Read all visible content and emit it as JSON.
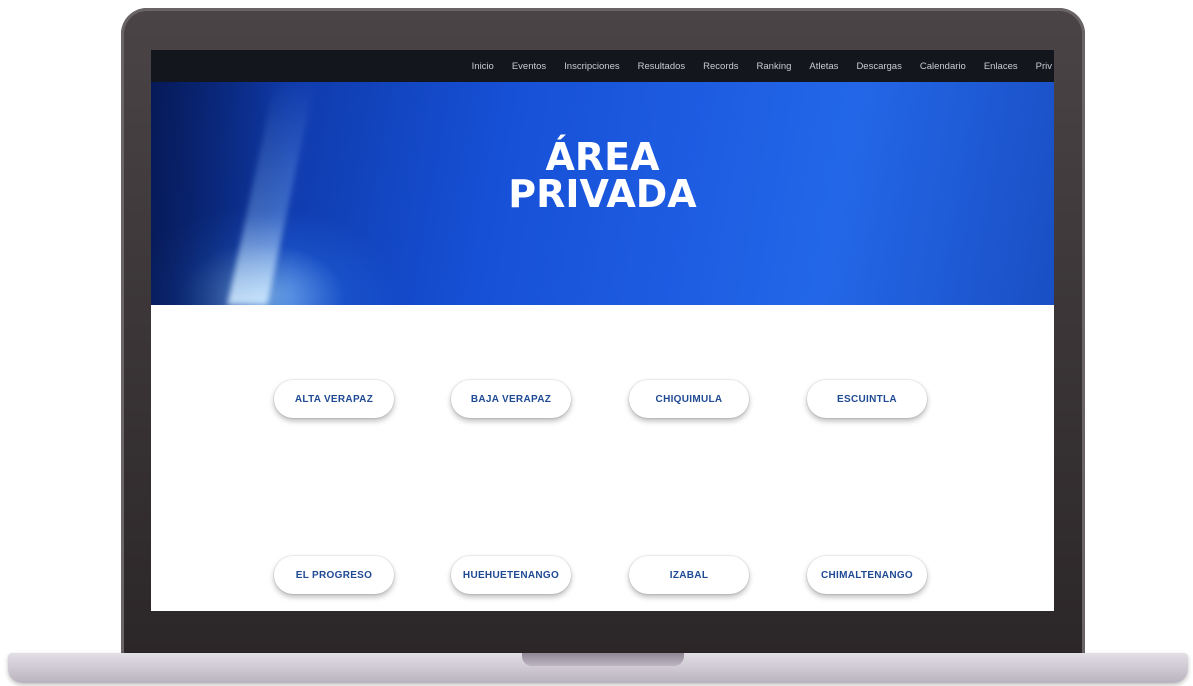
{
  "nav": {
    "items": [
      "Inicio",
      "Eventos",
      "Inscripciones",
      "Resultados",
      "Records",
      "Ranking",
      "Atletas",
      "Descargas",
      "Calendario",
      "Enlaces",
      "Priv"
    ]
  },
  "hero": {
    "title_line1": "ÁREA",
    "title_line2": "PRIVADA"
  },
  "departments": [
    "ALTA VERAPAZ",
    "BAJA VERAPAZ",
    "CHIQUIMULA",
    "ESCUINTLA",
    "EL PROGRESO",
    "HUEHUETENANGO",
    "IZABAL",
    "CHIMALTENANGO"
  ],
  "colors": {
    "hero_blue": "#1650d6",
    "button_text": "#1f4a94",
    "nav_bar": "#14161d"
  }
}
